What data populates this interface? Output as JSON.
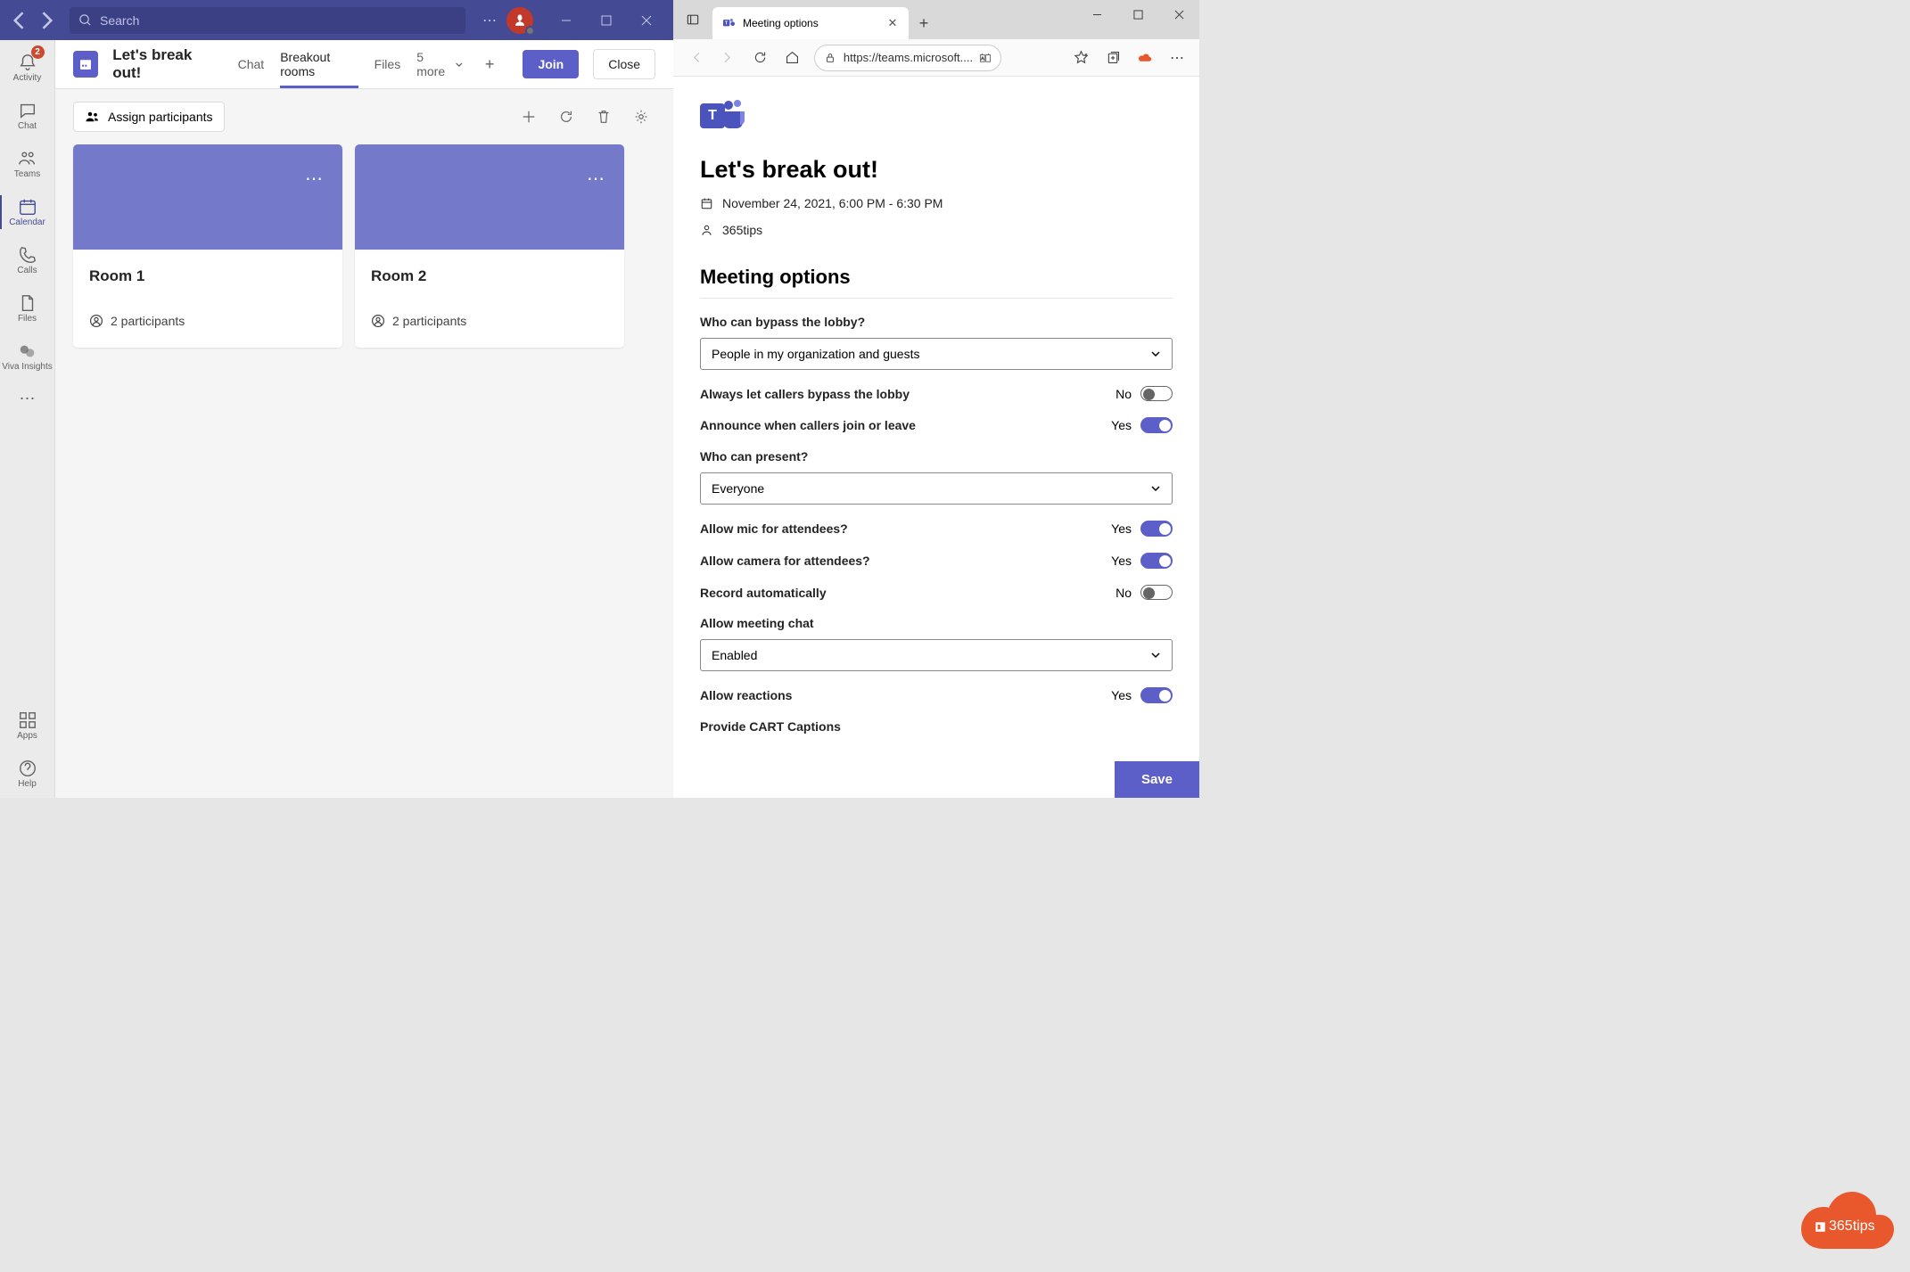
{
  "teams": {
    "search_placeholder": "Search",
    "rail": {
      "activity": "Activity",
      "activity_badge": "2",
      "chat": "Chat",
      "teams": "Teams",
      "calendar": "Calendar",
      "calls": "Calls",
      "files": "Files",
      "viva": "Viva Insights",
      "apps": "Apps",
      "help": "Help"
    },
    "meeting": {
      "title": "Let's break out!",
      "tabs": {
        "chat": "Chat",
        "breakout": "Breakout rooms",
        "files": "Files",
        "more": "5 more"
      },
      "join": "Join",
      "close": "Close",
      "assign": "Assign participants"
    },
    "rooms": [
      {
        "name": "Room 1",
        "participants": "2 participants"
      },
      {
        "name": "Room 2",
        "participants": "2 participants"
      }
    ]
  },
  "browser": {
    "tab_title": "Meeting options",
    "url": "https://teams.microsoft....",
    "page": {
      "title": "Let's break out!",
      "datetime": "November 24, 2021, 6:00 PM - 6:30 PM",
      "organizer": "365tips",
      "heading": "Meeting options",
      "lobby_label": "Who can bypass the lobby?",
      "lobby_value": "People in my organization and guests",
      "callers_bypass_label": "Always let callers bypass the lobby",
      "callers_bypass_val": "No",
      "announce_label": "Announce when callers join or leave",
      "announce_val": "Yes",
      "present_label": "Who can present?",
      "present_value": "Everyone",
      "mic_label": "Allow mic for attendees?",
      "mic_val": "Yes",
      "cam_label": "Allow camera for attendees?",
      "cam_val": "Yes",
      "record_label": "Record automatically",
      "record_val": "No",
      "chat_label": "Allow meeting chat",
      "chat_value": "Enabled",
      "reactions_label": "Allow reactions",
      "reactions_val": "Yes",
      "cart_label": "Provide CART Captions",
      "save": "Save"
    }
  },
  "watermark": "365tips"
}
